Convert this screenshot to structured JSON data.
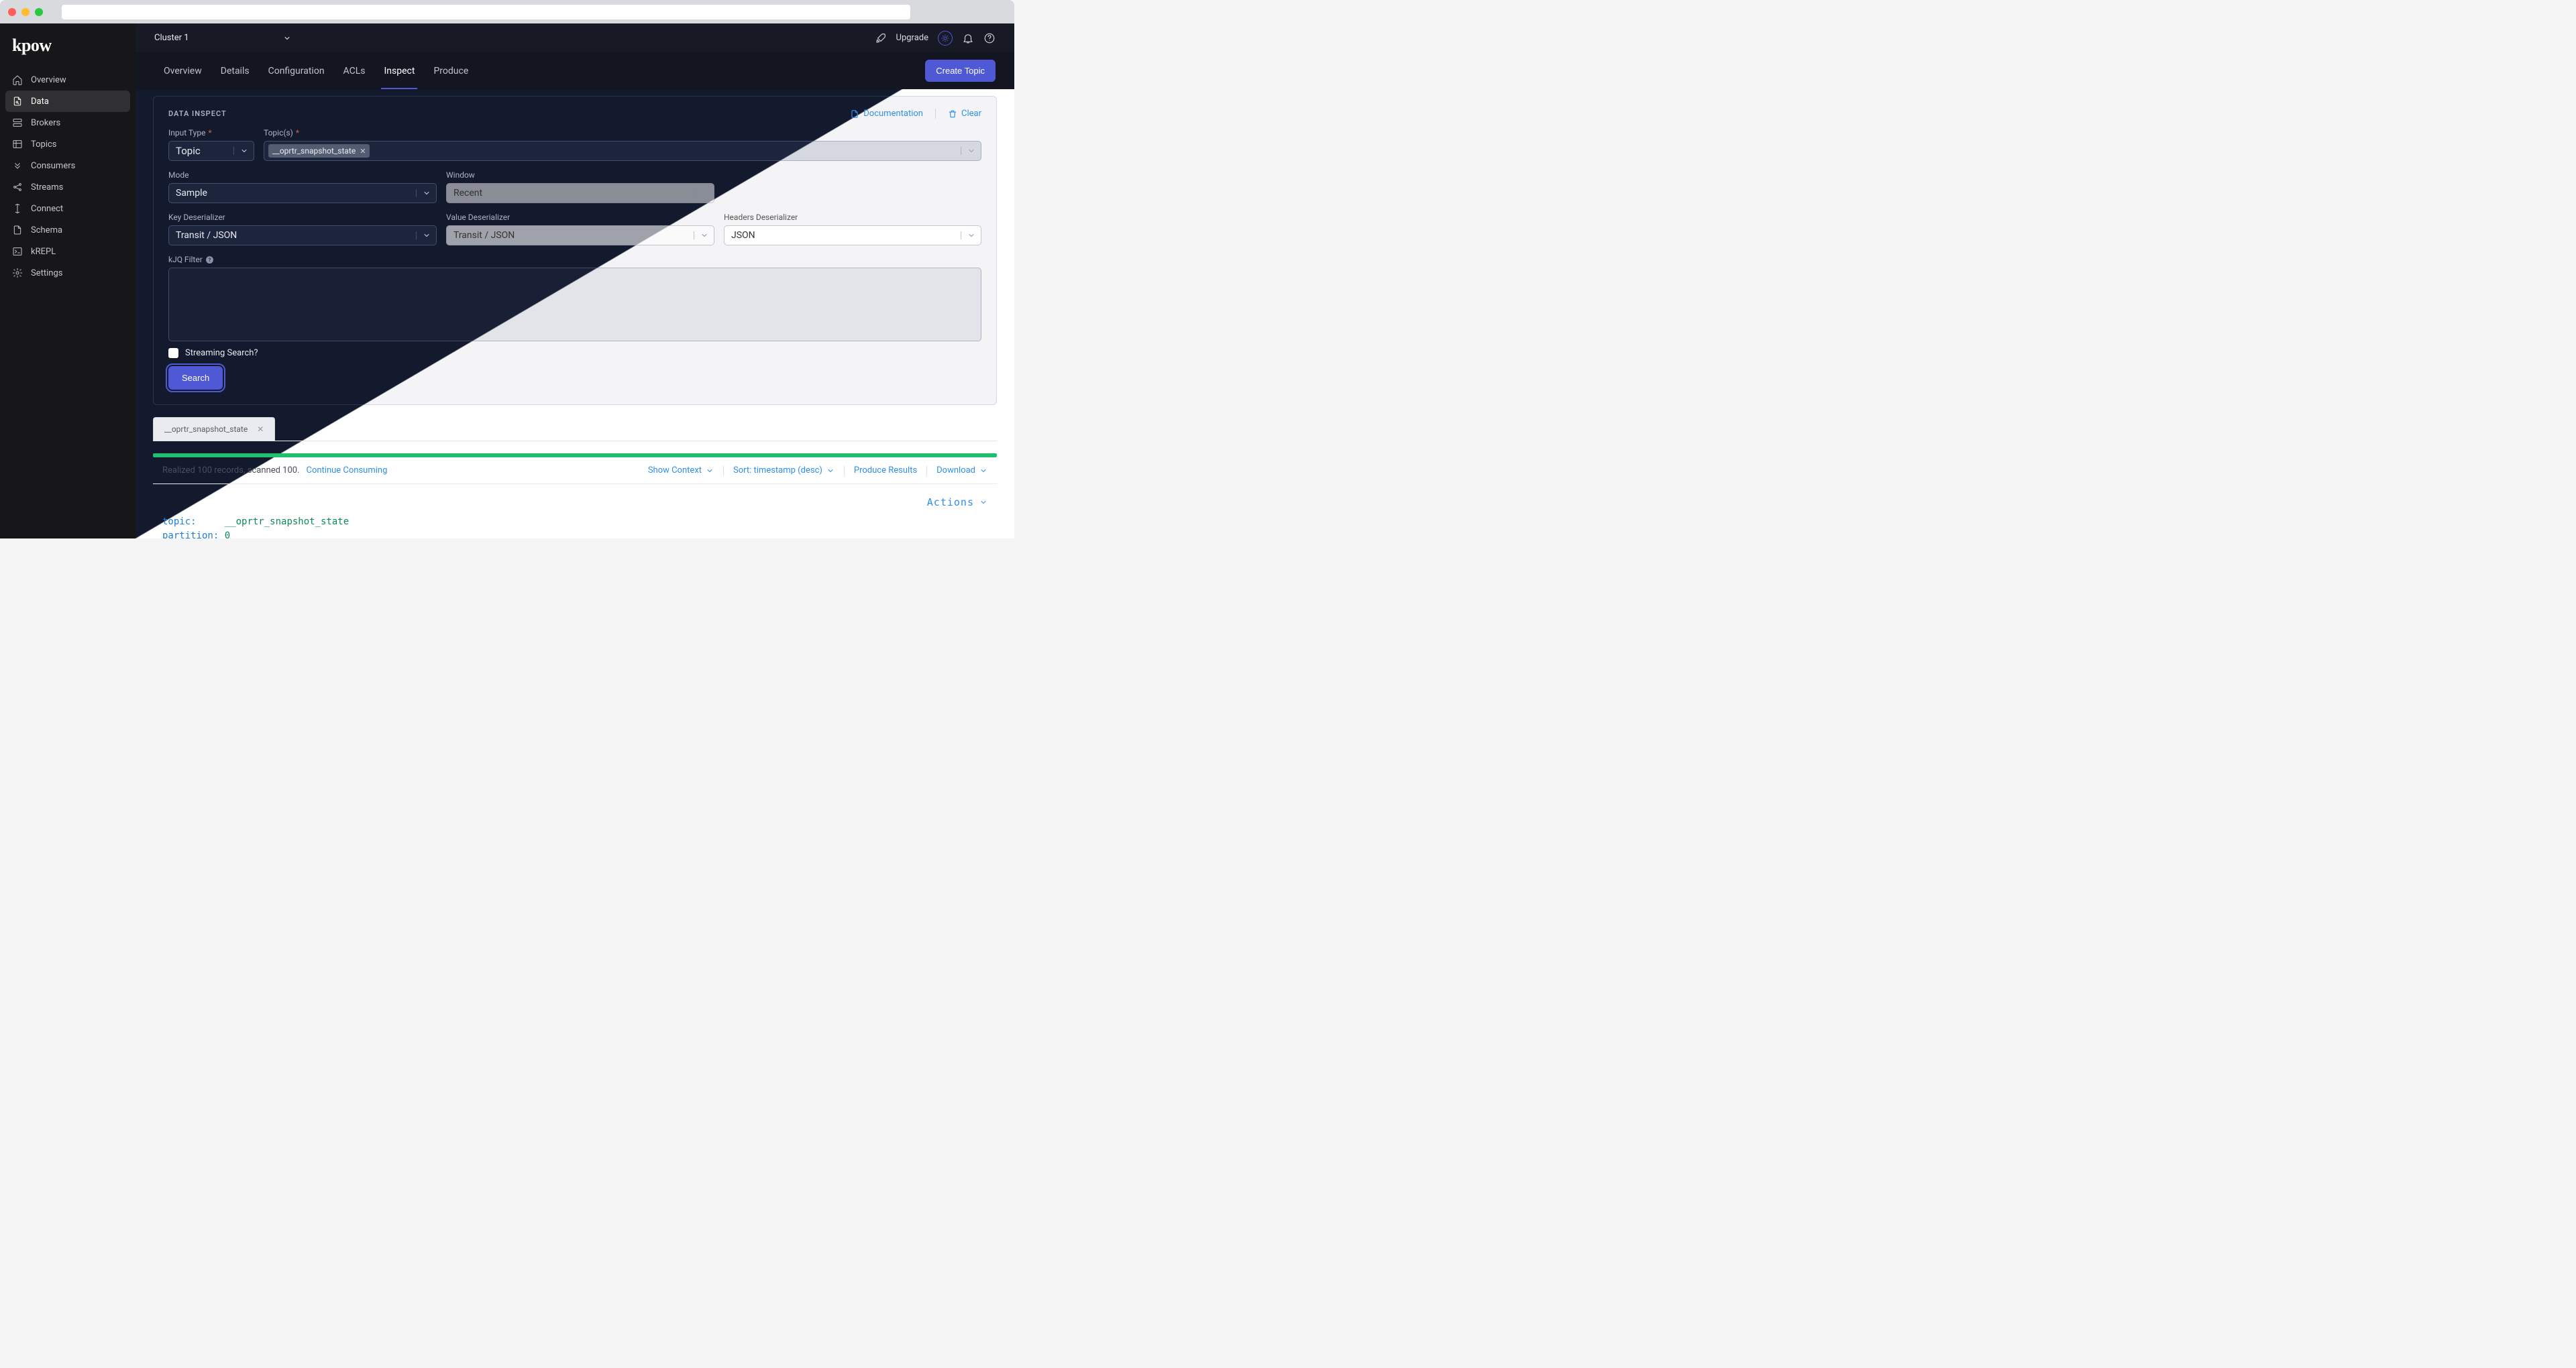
{
  "logo": "kpow",
  "cluster": "Cluster 1",
  "header": {
    "upgrade": "Upgrade"
  },
  "sidebar": {
    "items": [
      {
        "label": "Overview"
      },
      {
        "label": "Data"
      },
      {
        "label": "Brokers"
      },
      {
        "label": "Topics"
      },
      {
        "label": "Consumers"
      },
      {
        "label": "Streams"
      },
      {
        "label": "Connect"
      },
      {
        "label": "Schema"
      },
      {
        "label": "kREPL"
      },
      {
        "label": "Settings"
      }
    ]
  },
  "tabs": [
    "Overview",
    "Details",
    "Configuration",
    "ACLs",
    "Inspect",
    "Produce"
  ],
  "active_tab": "Inspect",
  "create_button": "Create Topic",
  "panel": {
    "title": "DATA INSPECT",
    "doc": "Documentation",
    "clear": "Clear",
    "input_type_label": "Input Type",
    "input_type_value": "Topic",
    "topics_label": "Topic(s)",
    "topic_token": "__oprtr_snapshot_state",
    "mode_label": "Mode",
    "mode_value": "Sample",
    "window_label": "Window",
    "window_value": "Recent",
    "key_deser_label": "Key Deserializer",
    "key_deser_value": "Transit / JSON",
    "val_deser_label": "Value Deserializer",
    "val_deser_value": "Transit / JSON",
    "hdr_deser_label": "Headers Deserializer",
    "hdr_deser_value": "JSON",
    "kjq_label": "kJQ Filter",
    "streaming_label": "Streaming Search?",
    "search": "Search"
  },
  "results": {
    "tab_label": "__oprtr_snapshot_state",
    "status": "Realized 100 records, scanned 100.",
    "continue": "Continue Consuming",
    "show_context": "Show Context",
    "sort": "Sort: timestamp (desc)",
    "produce_results": "Produce Results",
    "download": "Download",
    "actions": "Actions",
    "record": {
      "topic_k": "topic:",
      "topic_v": "__oprtr_snapshot_state",
      "part_k": "partition:",
      "part_v": "0"
    }
  }
}
